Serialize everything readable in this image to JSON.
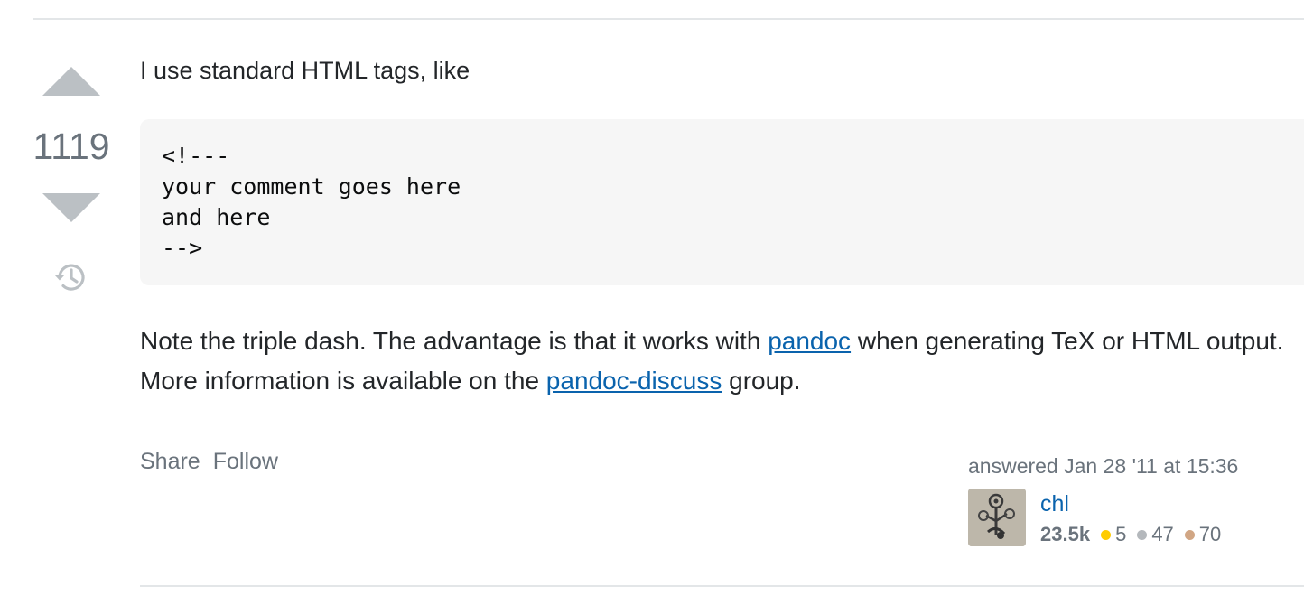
{
  "vote": {
    "score": "1119"
  },
  "answer": {
    "intro": "I use standard HTML tags, like",
    "code": "<!---\nyour comment goes here\nand here\n-->",
    "note": {
      "part1": "Note the triple dash. The advantage is that it works with ",
      "link1": "pandoc",
      "part2": " when generating TeX or HTML output. More information is available on the ",
      "link2": "pandoc-discuss",
      "part3": " group."
    }
  },
  "menu": {
    "share": "Share",
    "follow": "Follow"
  },
  "user_card": {
    "action": "answered Jan 28 '11 at 15:36",
    "name": "chl",
    "reputation": "23.5k",
    "gold": "5",
    "silver": "47",
    "bronze": "70"
  },
  "colors": {
    "link": "#0a63ad",
    "muted": "#6a737c",
    "vote_arrow": "#bbc0c4",
    "code_bg": "#f6f6f6",
    "badge_gold": "#ffcc01",
    "badge_silver": "#b4b8bc",
    "badge_bronze": "#d1a684"
  }
}
